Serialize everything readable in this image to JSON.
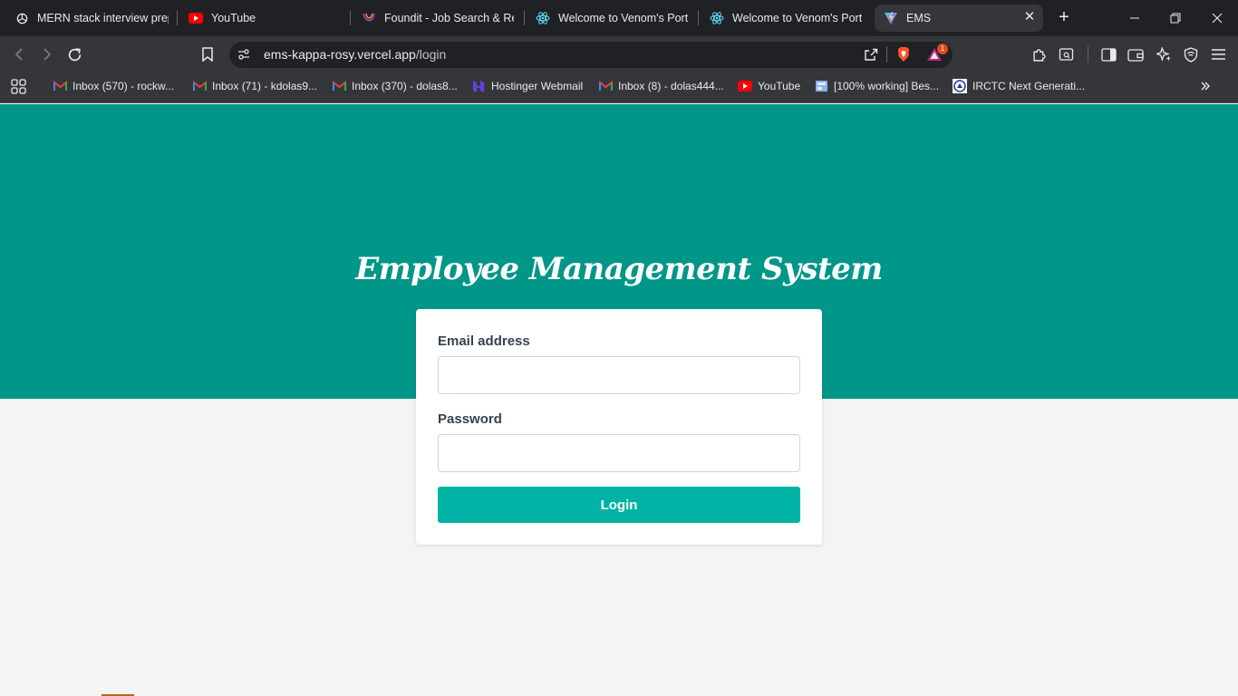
{
  "browser": {
    "tabs": [
      {
        "title": "MERN stack interview prep",
        "icon": "chatgpt-icon"
      },
      {
        "title": "YouTube",
        "icon": "youtube-icon"
      },
      {
        "title": "Foundit - Job Search & Rec",
        "icon": "foundit-icon"
      },
      {
        "title": "Welcome to Venom's Porta",
        "icon": "react-icon"
      },
      {
        "title": "Welcome to Venom's Porta",
        "icon": "react-icon"
      },
      {
        "title": "EMS",
        "icon": "vite-icon",
        "active": true
      }
    ],
    "url_host": "ems-kappa-rosy.vercel.app",
    "url_path": "/login",
    "brave_rewards_badge": "1",
    "bookmarks": [
      {
        "label": "Inbox (570) - rockw...",
        "icon": "gmail-icon"
      },
      {
        "label": "Inbox (71) - kdolas9...",
        "icon": "gmail-icon"
      },
      {
        "label": "Inbox (370) - dolas8...",
        "icon": "gmail-icon"
      },
      {
        "label": "Hostinger Webmail",
        "icon": "hostinger-icon"
      },
      {
        "label": "Inbox (8) - dolas444...",
        "icon": "gmail-icon"
      },
      {
        "label": "YouTube",
        "icon": "youtube-icon"
      },
      {
        "label": "[100% working] Bes...",
        "icon": "page-icon"
      },
      {
        "label": "IRCTC Next Generati...",
        "icon": "irctc-icon"
      }
    ],
    "colors": {
      "tabstrip": "#202124",
      "toolbar": "#35363a"
    }
  },
  "page": {
    "app_title": "Employee Management System",
    "email_label": "Email address",
    "email_value": "",
    "password_label": "Password",
    "password_value": "",
    "login_label": "Login",
    "colors": {
      "hero": "#009688",
      "button": "#00b3a4",
      "background": "#f3f4f6"
    }
  }
}
